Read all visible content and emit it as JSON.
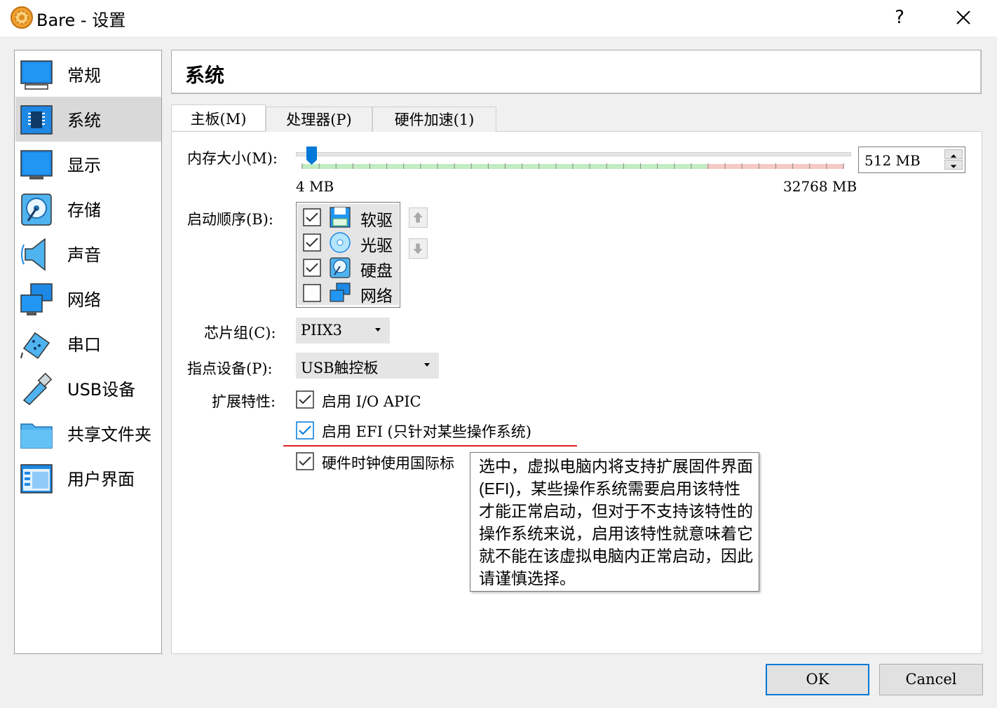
{
  "window": {
    "title": "Bare - 设置",
    "help": "?"
  },
  "sidebar": {
    "items": [
      {
        "label": "常规",
        "icon": "general-monitor-icon"
      },
      {
        "label": "系统",
        "icon": "system-chip-icon",
        "selected": true
      },
      {
        "label": "显示",
        "icon": "display-monitor-icon"
      },
      {
        "label": "存储",
        "icon": "storage-disk-icon"
      },
      {
        "label": "声音",
        "icon": "audio-speaker-icon"
      },
      {
        "label": "网络",
        "icon": "network-icon"
      },
      {
        "label": "串口",
        "icon": "serial-port-icon"
      },
      {
        "label": "USB设备",
        "icon": "usb-icon"
      },
      {
        "label": "共享文件夹",
        "icon": "shared-folder-icon"
      },
      {
        "label": "用户界面",
        "icon": "user-interface-icon"
      }
    ]
  },
  "page": {
    "title": "系统"
  },
  "tabs": [
    {
      "label": "主板(M)",
      "active": true
    },
    {
      "label": "处理器(P)"
    },
    {
      "label": "硬件加速(1)"
    }
  ],
  "motherboard": {
    "memory": {
      "label": "内存大小(M):",
      "value": "512 MB",
      "min_label": "4 MB",
      "max_label": "32768 MB",
      "value_mb": 512,
      "min_mb": 4,
      "max_mb": 32768
    },
    "boot_order": {
      "label": "启动顺序(B):",
      "items": [
        {
          "label": "软驱",
          "checked": true,
          "icon": "floppy-icon"
        },
        {
          "label": "光驱",
          "checked": true,
          "icon": "optical-disc-icon"
        },
        {
          "label": "硬盘",
          "checked": true,
          "icon": "hard-disk-icon"
        },
        {
          "label": "网络",
          "checked": false,
          "icon": "network-icon"
        }
      ]
    },
    "chipset": {
      "label": "芯片组(C):",
      "value": "PIIX3"
    },
    "pointing": {
      "label": "指点设备(P):",
      "value": "USB触控板"
    },
    "features": {
      "label": "扩展特性:",
      "io_apic": "启用 I/O APIC",
      "efi": "启用 EFI (只针对某些操作系统)",
      "utc": "硬件时钟使用国际标"
    }
  },
  "tooltip": "选中，虚拟电脑内将支持扩展固件界面 (EFI)，某些操作系统需要启用该特性才能正常启动，但对于不支持该特性的操作系统来说，启用该特性就意味着它就不能在该虚拟电脑内正常启动，因此请谨慎选择。",
  "buttons": {
    "ok": "OK",
    "cancel": "Cancel"
  },
  "colors": {
    "accent": "#0078d7",
    "annotation_underline": "#e02020",
    "slider_safe": "#c2ecc2",
    "slider_warn": "#f5c9c4"
  }
}
